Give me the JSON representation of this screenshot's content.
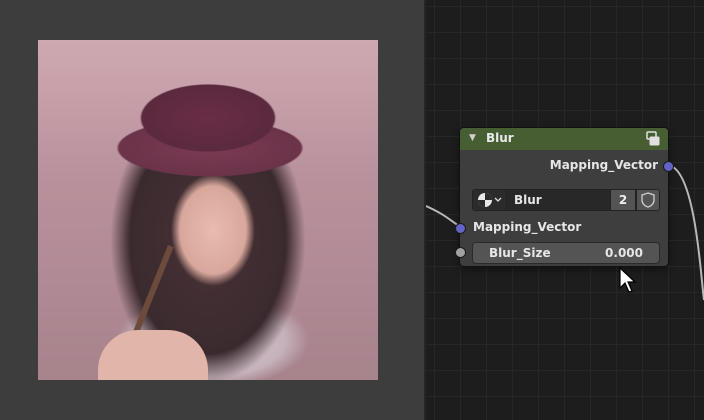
{
  "image_editor": {
    "image_description": "photo"
  },
  "node_editor": {
    "node": {
      "title": "Blur",
      "output_socket_label": "Mapping_Vector",
      "datablock_name": "Blur",
      "datablock_users": "2",
      "input_socket_label": "Mapping_Vector",
      "field_label": "Blur_Size",
      "field_value": "0.000",
      "colors": {
        "header": "#475e32",
        "body": "#3e3e3e",
        "socket_vector": "#6363c7"
      }
    },
    "icons": [
      "collapse-arrow-icon",
      "node-group-icon",
      "texture-type-icon",
      "chevron-down-icon",
      "fake-user-shield-icon"
    ]
  }
}
